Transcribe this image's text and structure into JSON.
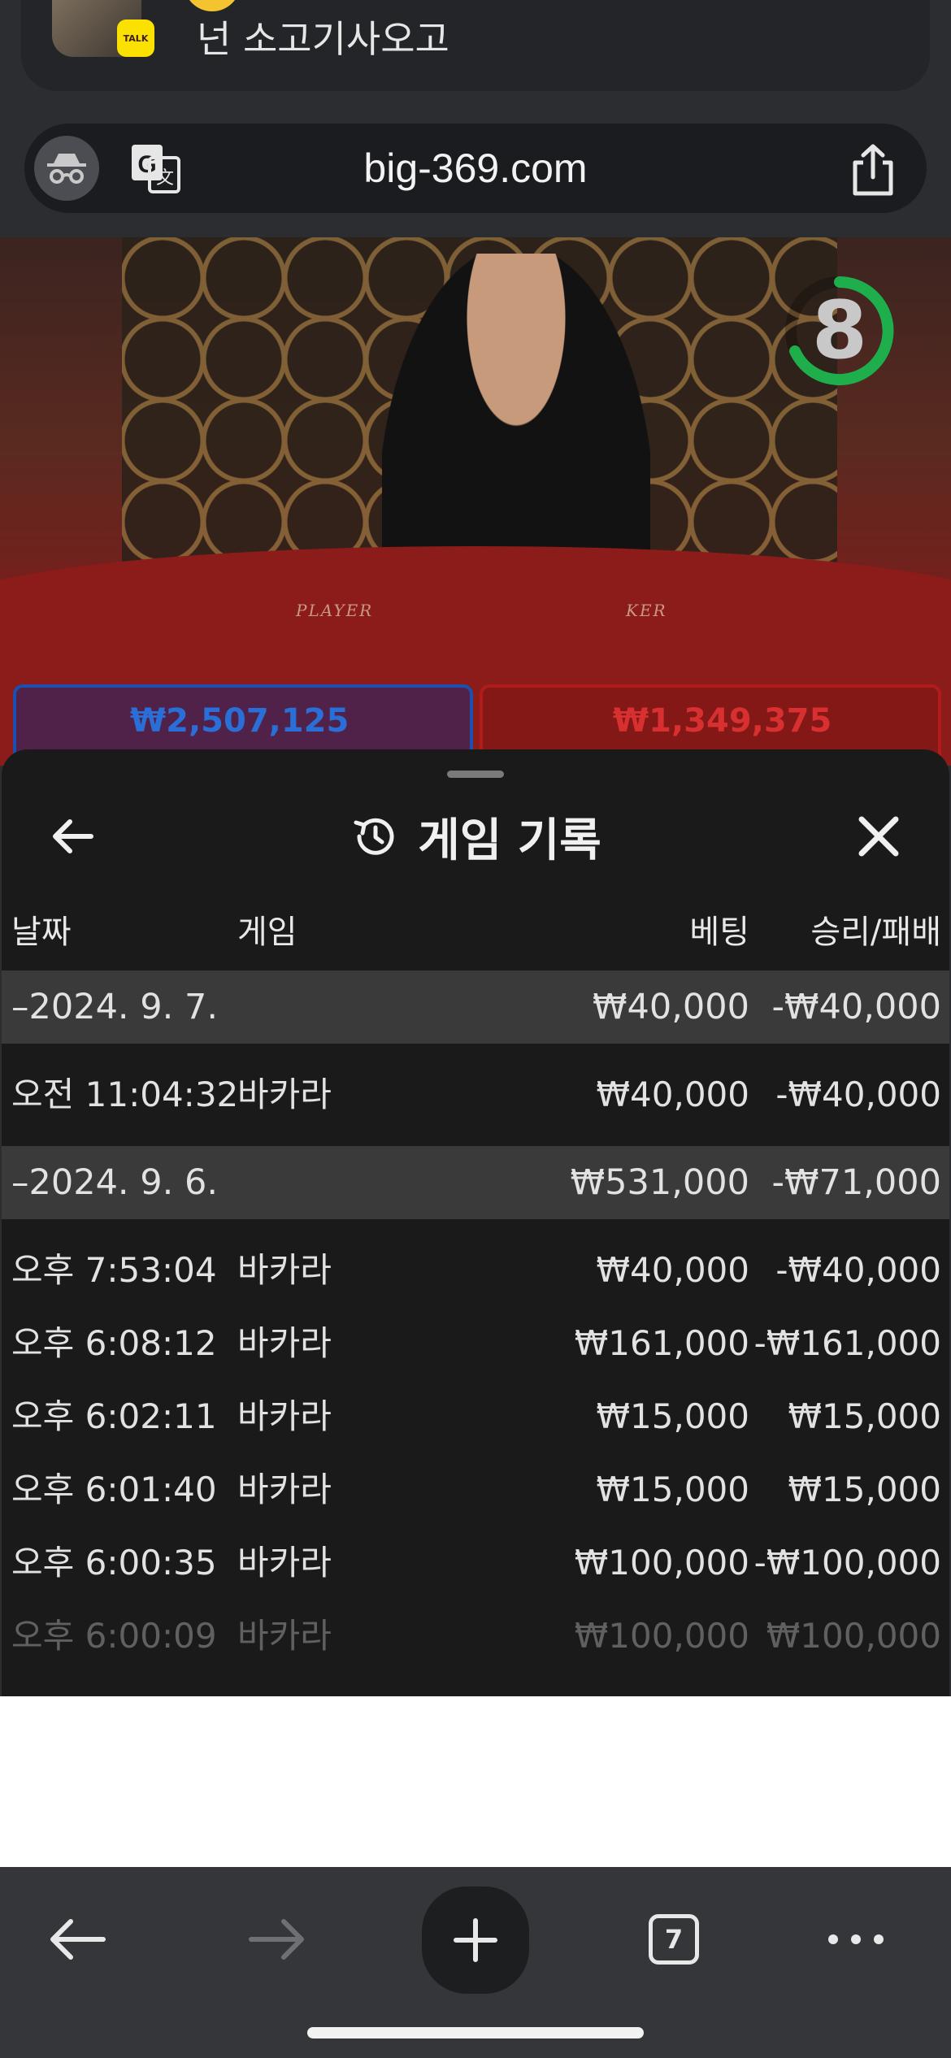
{
  "notification": {
    "message": "넌 소고기사오고",
    "app_badge": "TALK"
  },
  "browser": {
    "url": "big-369.com",
    "tab_count": "7"
  },
  "video": {
    "countdown": "8",
    "player_label": "PLAYER",
    "banker_label": "KER",
    "player_bet": "₩2,507,125",
    "banker_bet": "₩1,349,375"
  },
  "sheet": {
    "title": "게임 기록",
    "columns": {
      "date": "날짜",
      "game": "게임",
      "bet": "베팅",
      "win_loss": "승리/패배"
    },
    "rows": [
      {
        "type": "group",
        "date": "–2024. 9. 7.",
        "game": "",
        "bet": "₩40,000",
        "result": "-₩40,000"
      },
      {
        "type": "item",
        "date": "오전 11:04:32",
        "game": "바카라",
        "bet": "₩40,000",
        "result": "-₩40,000"
      },
      {
        "type": "group",
        "date": "–2024. 9. 6.",
        "game": "",
        "bet": "₩531,000",
        "result": "-₩71,000"
      },
      {
        "type": "item",
        "date": "오후 7:53:04",
        "game": "바카라",
        "bet": "₩40,000",
        "result": "-₩40,000"
      },
      {
        "type": "item",
        "date": "오후 6:08:12",
        "game": "바카라",
        "bet": "₩161,000",
        "result": "-₩161,000"
      },
      {
        "type": "item",
        "date": "오후 6:02:11",
        "game": "바카라",
        "bet": "₩15,000",
        "result": "₩15,000"
      },
      {
        "type": "item",
        "date": "오후 6:01:40",
        "game": "바카라",
        "bet": "₩15,000",
        "result": "₩15,000"
      },
      {
        "type": "item",
        "date": "오후 6:00:35",
        "game": "바카라",
        "bet": "₩100,000",
        "result": "-₩100,000"
      },
      {
        "type": "item",
        "date": "오후 6:00:09",
        "game": "바카라",
        "bet": "₩100,000",
        "result": "₩100,000"
      }
    ]
  },
  "colors": {
    "sheet_bg": "#1a1a1a",
    "group_row_bg": "#3a3a3a",
    "timer_green": "#1fae4c",
    "player_blue": "#1b4fb0",
    "banker_red": "#b01b1b",
    "talk_yellow": "#fae100"
  }
}
